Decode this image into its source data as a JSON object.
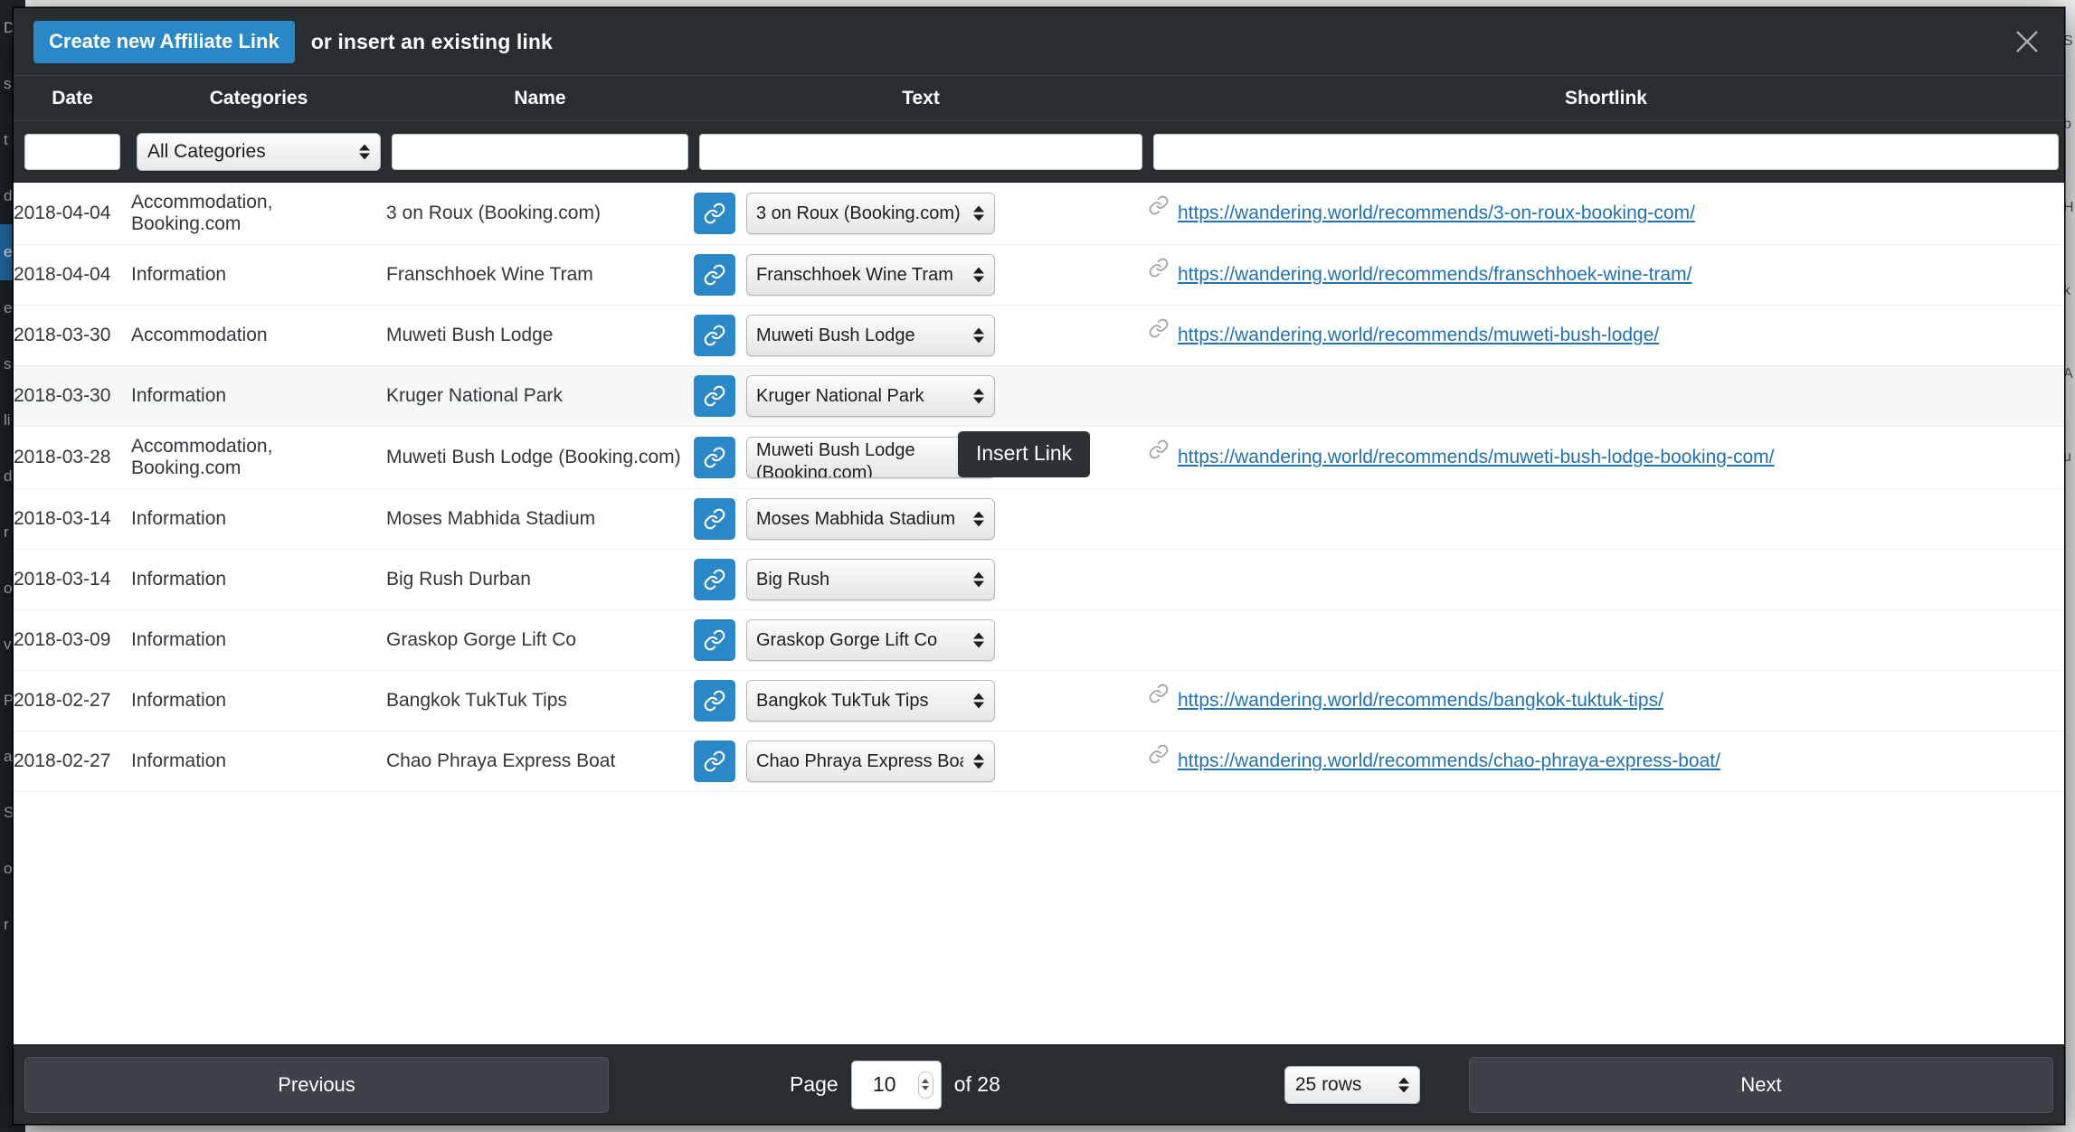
{
  "modal": {
    "create_button_label": "Create new Affiliate Link",
    "header_caption": "or insert an existing link",
    "close_icon": "close-icon"
  },
  "columns": [
    {
      "key": "date",
      "label": "Date"
    },
    {
      "key": "categories",
      "label": "Categories"
    },
    {
      "key": "name",
      "label": "Name"
    },
    {
      "key": "text",
      "label": "Text"
    },
    {
      "key": "shortlink",
      "label": "Shortlink"
    }
  ],
  "filters": {
    "date_value": "",
    "date_placeholder": "",
    "category_selected": "All Categories",
    "category_options": [
      "All Categories"
    ],
    "name_value": "",
    "name_placeholder": "",
    "text_value": "",
    "text_placeholder": "",
    "shortlink_value": "",
    "shortlink_placeholder": ""
  },
  "tooltip": {
    "label": "Insert Link"
  },
  "icons": {
    "insert_link_button": "link-chain-icon",
    "shortlink_prefix": "link-chain-icon",
    "select_stepper": "up-down-arrows-icon"
  },
  "colors": {
    "accent_blue": "#2a87c8",
    "link_blue": "#2271b1",
    "modal_dark": "#282d31",
    "row_alt": "#f6f7f7"
  },
  "rows": [
    {
      "date": "2018-04-04",
      "categories": "Accommodation, Booking.com",
      "name": "3 on Roux (Booking.com)",
      "text_select": "3 on Roux (Booking.com)",
      "shortlink": "https://wandering.world/recommends/3-on-roux-booking-com/",
      "highlighted": false
    },
    {
      "date": "2018-04-04",
      "categories": "Information",
      "name": "Franschhoek Wine Tram",
      "text_select": "Franschhoek Wine Tram",
      "shortlink": "https://wandering.world/recommends/franschhoek-wine-tram/",
      "highlighted": false
    },
    {
      "date": "2018-03-30",
      "categories": "Accommodation",
      "name": "Muweti Bush Lodge",
      "text_select": "Muweti Bush Lodge",
      "shortlink": "https://wandering.world/recommends/muweti-bush-lodge/",
      "highlighted": false
    },
    {
      "date": "2018-03-30",
      "categories": "Information",
      "name": "Kruger National Park",
      "text_select": "Kruger National Park",
      "shortlink": "",
      "highlighted": true
    },
    {
      "date": "2018-03-28",
      "categories": "Accommodation, Booking.com",
      "name": "Muweti Bush Lodge (Booking.com)",
      "text_select": "Muweti Bush Lodge (Booking.com)",
      "shortlink": "https://wandering.world/recommends/muweti-bush-lodge-booking-com/",
      "highlighted": false
    },
    {
      "date": "2018-03-14",
      "categories": "Information",
      "name": "Moses Mabhida Stadium",
      "text_select": "Moses Mabhida Stadium",
      "shortlink": "",
      "highlighted": false
    },
    {
      "date": "2018-03-14",
      "categories": "Information",
      "name": "Big Rush Durban",
      "text_select": "Big Rush",
      "shortlink": "",
      "highlighted": false
    },
    {
      "date": "2018-03-09",
      "categories": "Information",
      "name": "Graskop Gorge Lift Co",
      "text_select": "Graskop Gorge Lift Co",
      "shortlink": "",
      "highlighted": false
    },
    {
      "date": "2018-02-27",
      "categories": "Information",
      "name": "Bangkok TukTuk Tips",
      "text_select": "Bangkok TukTuk Tips",
      "shortlink": "https://wandering.world/recommends/bangkok-tuktuk-tips/",
      "highlighted": false
    },
    {
      "date": "2018-02-27",
      "categories": "Information",
      "name": "Chao Phraya Express Boat",
      "text_select": "Chao Phraya Express Boat",
      "shortlink": "https://wandering.world/recommends/chao-phraya-express-boat/",
      "highlighted": false
    }
  ],
  "footer": {
    "previous_label": "Previous",
    "next_label": "Next",
    "page_label": "Page",
    "page_value": "10",
    "of_label": "of 28",
    "rows_selected": "25 rows",
    "rows_options": [
      "25 rows"
    ]
  },
  "backdrop": {
    "sidebar_ghosts": [
      "D",
      "s",
      "t",
      "d",
      "e",
      "e",
      "s",
      "li",
      "d",
      "r",
      "o",
      "v",
      "P",
      "al",
      "S",
      "o",
      "r"
    ],
    "right_ghosts": [
      "S",
      "b",
      "H",
      "k",
      "A",
      "u"
    ]
  }
}
